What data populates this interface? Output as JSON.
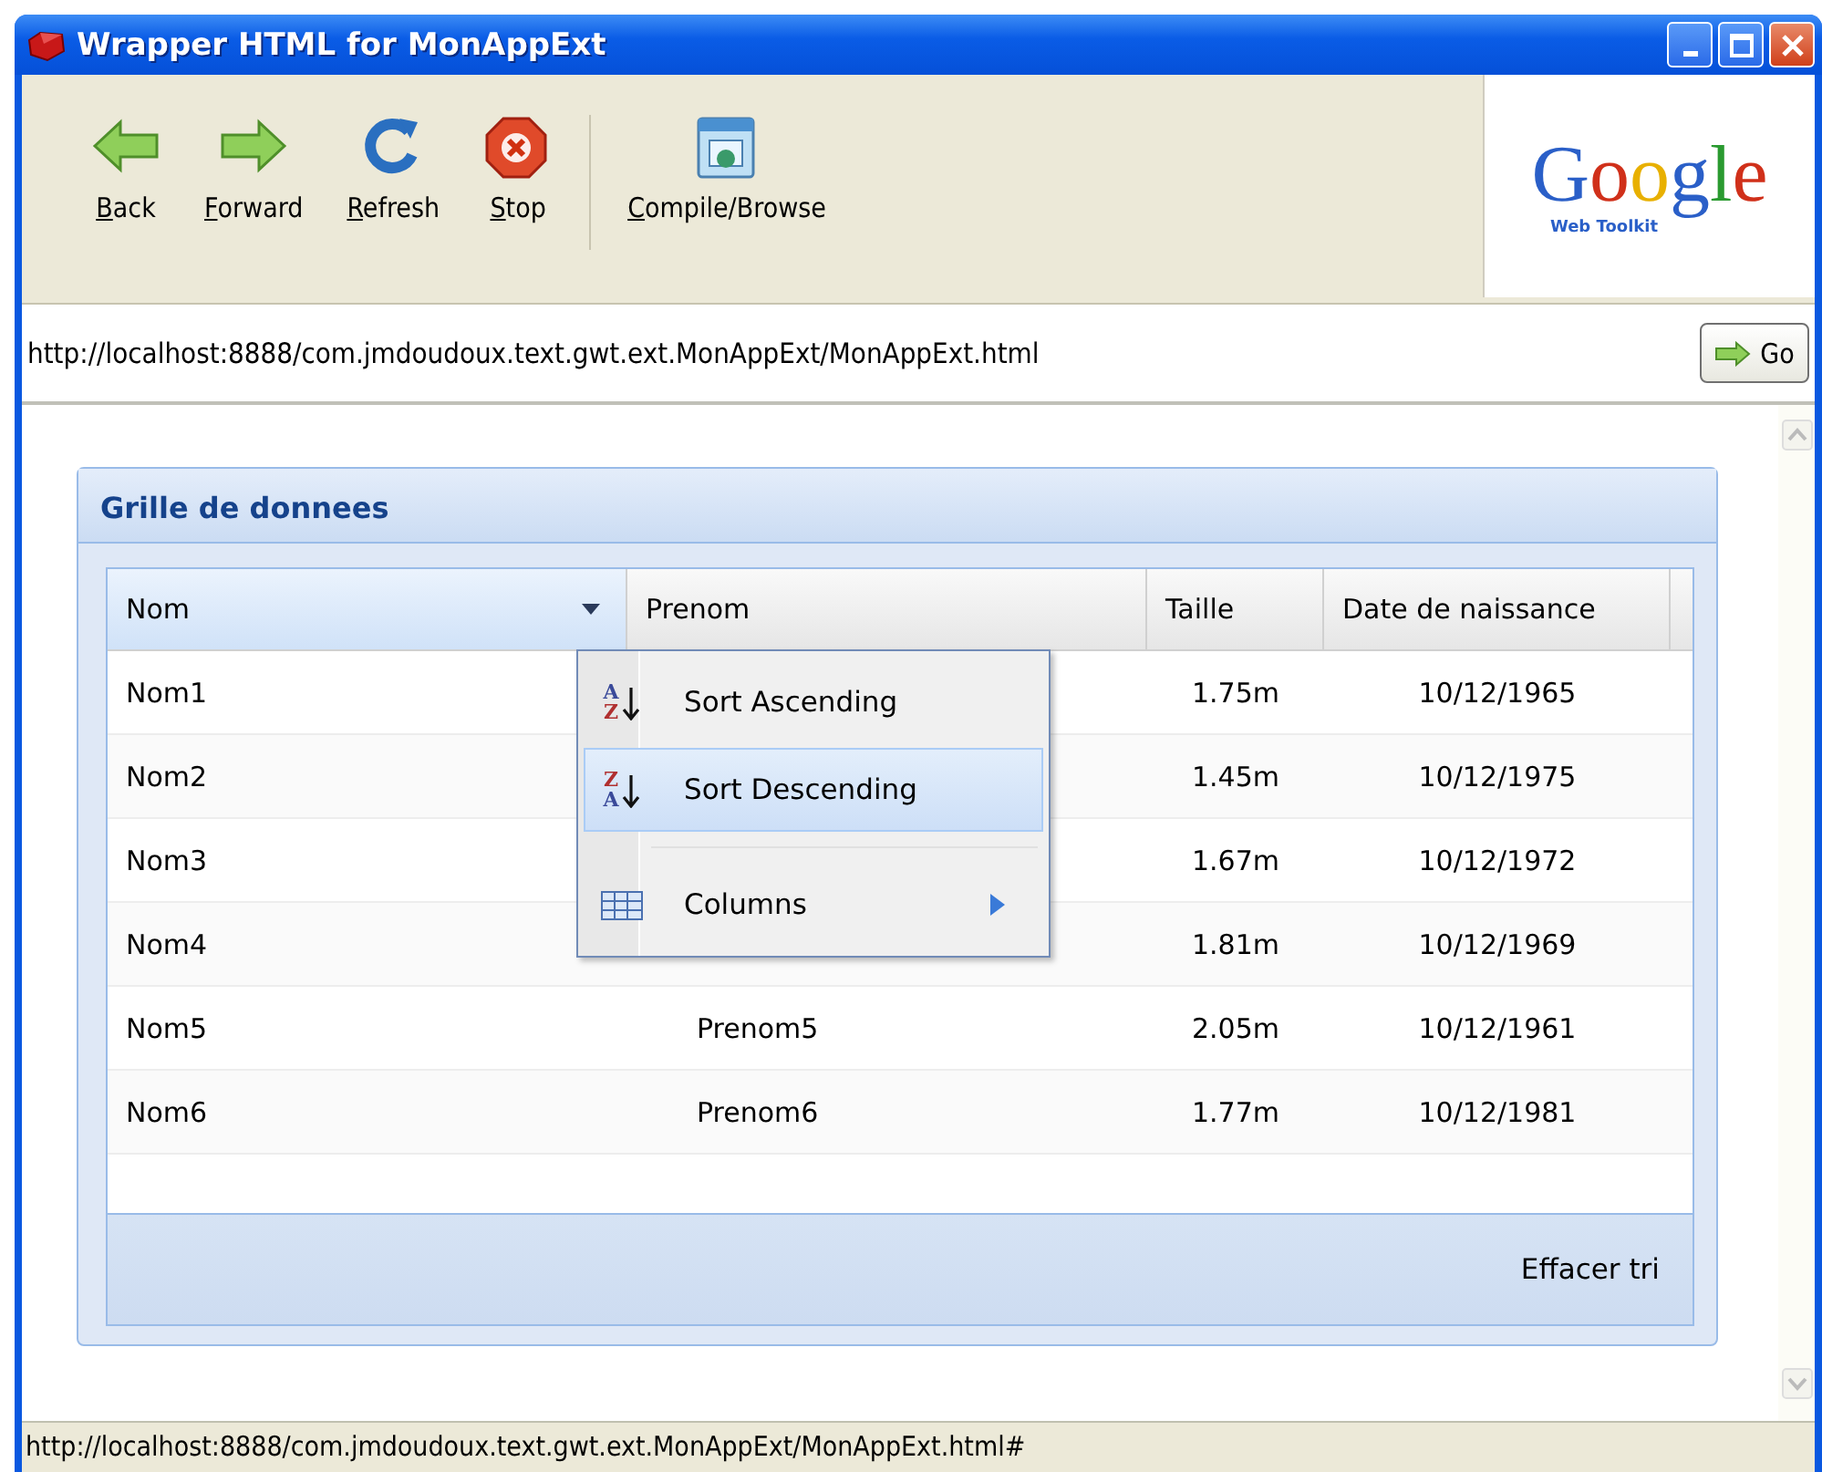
{
  "window": {
    "title": "Wrapper HTML for MonAppExt"
  },
  "toolbar": {
    "buttons": [
      {
        "label": "Back",
        "kind": "back"
      },
      {
        "label": "Forward",
        "kind": "forward"
      },
      {
        "label": "Refresh",
        "kind": "refresh"
      },
      {
        "label": "Stop",
        "kind": "stop"
      },
      {
        "label": "Compile/Browse",
        "kind": "compile"
      }
    ],
    "logo": {
      "wordmark": "Google",
      "subtitle": "Web Toolkit"
    }
  },
  "address_bar": {
    "value": "http://localhost:8888/com.jmdoudoux.text.gwt.ext.MonAppExt/MonAppExt.html",
    "go_button": "Go"
  },
  "panel": {
    "title": "Grille de donnees",
    "columns": [
      {
        "label": "Nom",
        "menu_open": true
      },
      {
        "label": "Prenom",
        "menu_open": false
      },
      {
        "label": "Taille",
        "menu_open": false
      },
      {
        "label": "Date de naissance",
        "menu_open": false
      }
    ],
    "rows": [
      {
        "nom": "Nom1",
        "taille": "1.75m",
        "date": "10/12/1965"
      },
      {
        "nom": "Nom2",
        "taille": "1.45m",
        "date": "10/12/1975"
      },
      {
        "nom": "Nom3",
        "taille": "1.67m",
        "date": "10/12/1972"
      },
      {
        "nom": "Nom4",
        "taille": "1.81m",
        "date": "10/12/1969"
      },
      {
        "nom": "Nom5",
        "prenom": "Prenom5",
        "taille": "2.05m",
        "date": "10/12/1961"
      },
      {
        "nom": "Nom6",
        "prenom": "Prenom6",
        "taille": "1.77m",
        "date": "10/12/1981"
      }
    ],
    "column_menu": [
      {
        "label": "Sort Ascending",
        "kind": "sort-asc",
        "icon_text": [
          "A",
          "Z"
        ],
        "selected": false
      },
      {
        "label": "Sort Descending",
        "kind": "sort-desc",
        "icon_text": [
          "Z",
          "A"
        ],
        "selected": true
      },
      {
        "kind": "separator"
      },
      {
        "label": "Columns",
        "kind": "columns",
        "selected": false,
        "has_submenu": true
      }
    ],
    "footer_button": "Effacer tri"
  },
  "status_bar": "http://localhost:8888/com.jmdoudoux.text.gwt.ext.MonAppExt/MonAppExt.html#"
}
